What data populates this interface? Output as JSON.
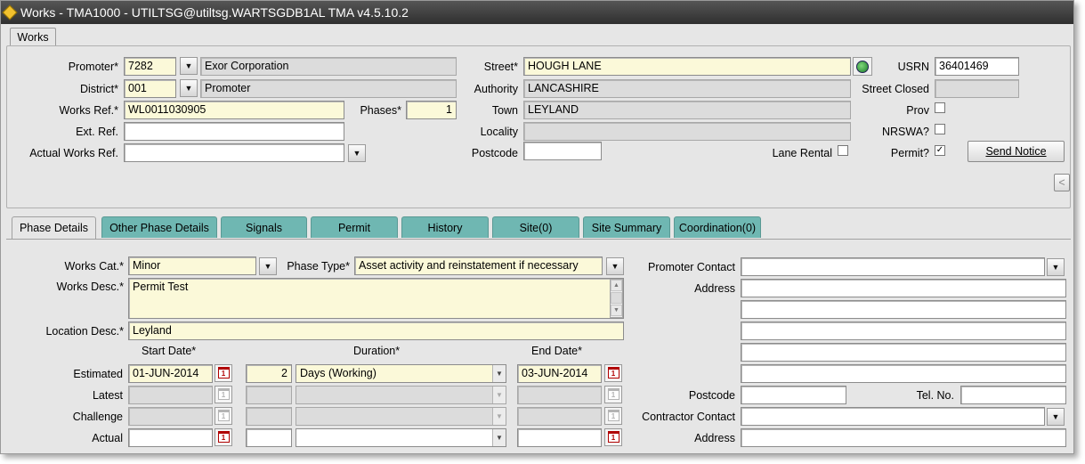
{
  "window": {
    "title": "Works - TMA1000 - UTILTSG@utiltsg.WARTSGDB1AL TMA v4.5.10.2",
    "top_tab": "Works"
  },
  "header": {
    "promoter_label": "Promoter*",
    "promoter_code": "7282",
    "promoter_name": "Exor Corporation",
    "district_label": "District*",
    "district_code": "001",
    "district_name": "Promoter",
    "works_ref_label": "Works Ref.*",
    "works_ref": "WL0011030905",
    "phases_label": "Phases*",
    "phases": "1",
    "ext_ref_label": "Ext. Ref.",
    "ext_ref": "",
    "actual_works_ref_label": "Actual Works Ref.",
    "actual_works_ref": "",
    "street_label": "Street*",
    "street": "HOUGH LANE",
    "authority_label": "Authority",
    "authority": "LANCASHIRE",
    "town_label": "Town",
    "town": "LEYLAND",
    "locality_label": "Locality",
    "locality": "",
    "postcode_label": "Postcode",
    "postcode": "",
    "lane_rental_label": "Lane Rental",
    "usrn_label": "USRN",
    "usrn": "36401469",
    "street_closed_label": "Street Closed",
    "street_closed": "",
    "prov_label": "Prov",
    "nrswa_label": "NRSWA?",
    "permit_label": "Permit?",
    "permit_checked": "✓",
    "send_notice_label": "Send Notice",
    "collapse_label": "<"
  },
  "tabs": [
    {
      "label": "Phase Details"
    },
    {
      "label": "Other Phase Details"
    },
    {
      "label": "Signals"
    },
    {
      "label": "Permit"
    },
    {
      "label": "History"
    },
    {
      "label": "Site(0)"
    },
    {
      "label": "Site Summary"
    },
    {
      "label": "Coordination(0)"
    }
  ],
  "phase": {
    "works_cat_label": "Works Cat.*",
    "works_cat": "Minor",
    "phase_type_label": "Phase Type*",
    "phase_type": "Asset activity and reinstatement if necessary",
    "works_desc_label": "Works Desc.*",
    "works_desc": "Permit Test",
    "location_desc_label": "Location Desc.*",
    "location_desc": "Leyland",
    "start_date_header": "Start Date*",
    "duration_header": "Duration*",
    "end_date_header": "End Date*",
    "rows": [
      {
        "label": "Estimated",
        "start": "01-JUN-2014",
        "duration": "2",
        "unit": "Days (Working)",
        "end": "03-JUN-2014"
      },
      {
        "label": "Latest",
        "start": "",
        "duration": "",
        "unit": "",
        "end": ""
      },
      {
        "label": "Challenge",
        "start": "",
        "duration": "",
        "unit": "",
        "end": ""
      },
      {
        "label": "Actual",
        "start": "",
        "duration": "",
        "unit": "",
        "end": ""
      }
    ],
    "promoter_contact_label": "Promoter Contact",
    "promoter_contact": "",
    "address_label": "Address",
    "contact_postcode_label": "Postcode",
    "tel_no_label": "Tel. No.",
    "contractor_contact_label": "Contractor Contact",
    "contractor_contact": "",
    "contractor_address_label": "Address"
  },
  "colors": {
    "tab_teal": "#6fb7b2",
    "required_field": "#fbf9d9",
    "readonly_field": "#dcdcdc",
    "form_background": "#e6e6e6"
  }
}
